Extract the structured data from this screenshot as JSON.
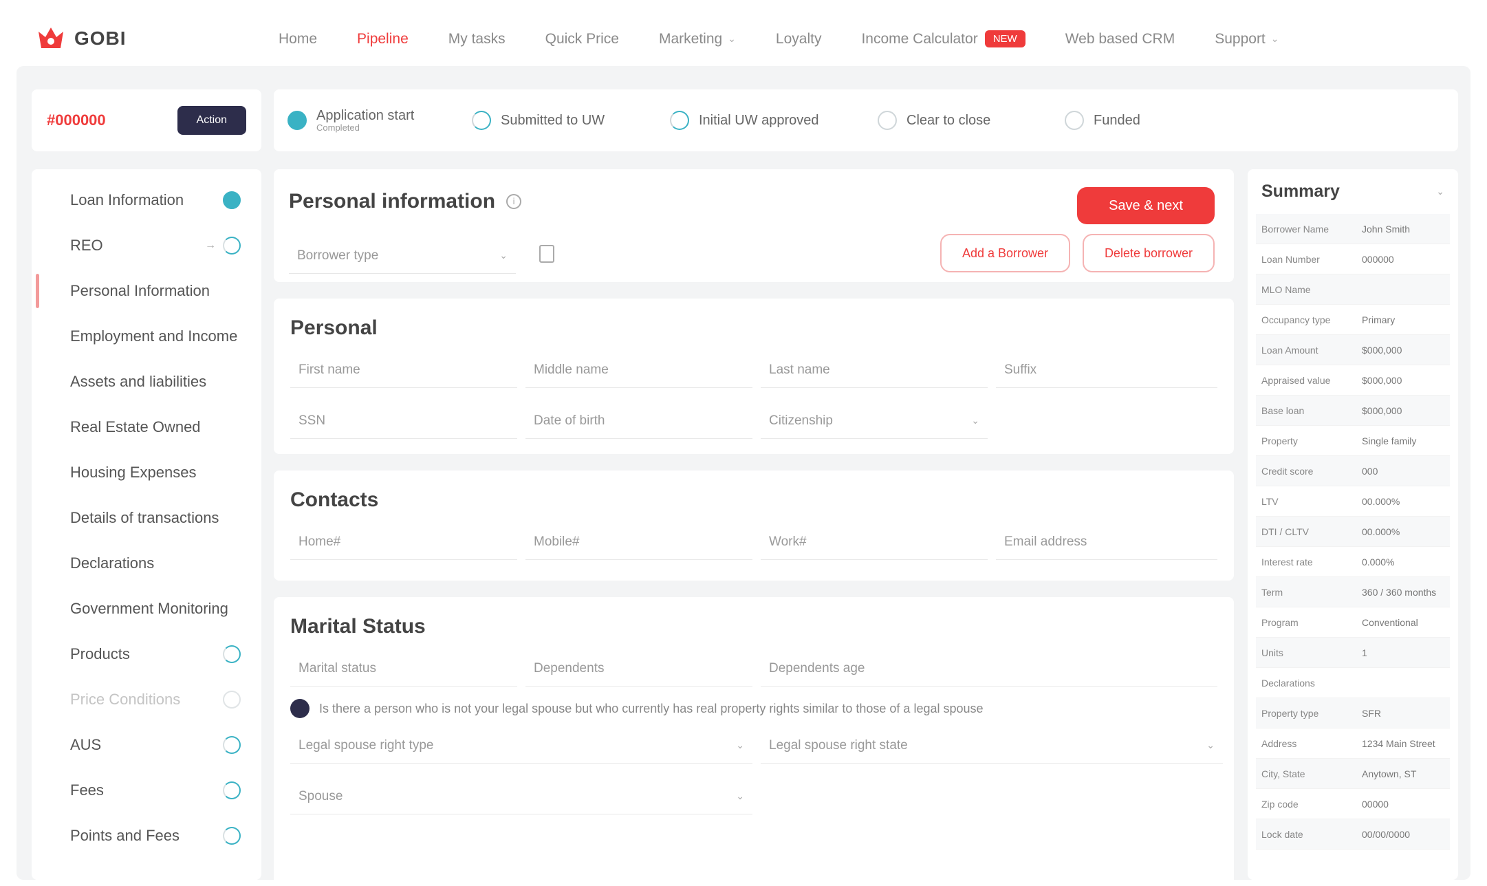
{
  "brand": {
    "name": "GOBI",
    "tagline": "",
    "accent": "#ef3b3b",
    "dark": "#2d2d4b",
    "teal": "#3ab2c4"
  },
  "nav": [
    {
      "label": "Home",
      "active": false,
      "dropdown": false
    },
    {
      "label": "Pipeline",
      "active": true,
      "dropdown": false
    },
    {
      "label": "My tasks",
      "active": false,
      "dropdown": false
    },
    {
      "label": "Quick Price",
      "active": false,
      "dropdown": false
    },
    {
      "label": "Marketing",
      "active": false,
      "dropdown": true
    },
    {
      "label": "Loyalty",
      "active": false,
      "dropdown": false
    },
    {
      "label": "Income Calculator",
      "active": false,
      "dropdown": false,
      "badge": "NEW"
    },
    {
      "label": "Web based CRM",
      "active": false,
      "dropdown": false
    },
    {
      "label": "Support",
      "active": false,
      "dropdown": true
    }
  ],
  "user": {
    "name": "",
    "sub": ""
  },
  "loan": {
    "id": "#000000",
    "button_label": "Action"
  },
  "steps": [
    {
      "label": "Application start",
      "sub": "Completed",
      "state": "done"
    },
    {
      "label": "Submitted to UW",
      "state": "half"
    },
    {
      "label": "Initial UW approved",
      "state": "half"
    },
    {
      "label": "Clear to close",
      "state": "empty"
    },
    {
      "label": "Funded",
      "state": "empty"
    }
  ],
  "sidebar": [
    {
      "label": "Loan Information",
      "icon": "done",
      "active": false,
      "muted": false
    },
    {
      "label": "REO",
      "icon": "half",
      "arrow": true,
      "active": false,
      "muted": false
    },
    {
      "label": "Personal Information",
      "icon": "none",
      "active": true,
      "muted": false
    },
    {
      "label": "Employment and Income",
      "icon": "none",
      "active": false,
      "muted": false
    },
    {
      "label": "Assets and liabilities",
      "icon": "none",
      "active": false,
      "muted": false
    },
    {
      "label": "Real Estate Owned",
      "icon": "none",
      "active": false,
      "muted": false
    },
    {
      "label": "Housing Expenses",
      "icon": "none",
      "active": false,
      "muted": false
    },
    {
      "label": "Details of transactions",
      "icon": "none",
      "active": false,
      "muted": false
    },
    {
      "label": "Declarations",
      "icon": "none",
      "active": false,
      "muted": false
    },
    {
      "label": "Government Monitoring",
      "icon": "none",
      "active": false,
      "muted": false
    },
    {
      "label": "Products",
      "icon": "half",
      "active": false,
      "muted": false
    },
    {
      "label": "Price Conditions",
      "icon": "empty",
      "active": false,
      "muted": true
    },
    {
      "label": "AUS",
      "icon": "half",
      "active": false,
      "muted": false
    },
    {
      "label": "Fees",
      "icon": "half",
      "active": false,
      "muted": false
    },
    {
      "label": "Points and Fees",
      "icon": "half",
      "active": false,
      "muted": false
    }
  ],
  "header": {
    "title": "Personal information",
    "primary_button": "Save & next",
    "borrower_placeholder": "Borrower type",
    "add_button": "Add a Borrower",
    "delete_button": "Delete borrower"
  },
  "personal": {
    "title": "Personal",
    "row1": [
      "First name",
      "Middle name",
      "Last name",
      "Suffix"
    ],
    "row2": [
      "SSN",
      "Date of birth",
      "Citizenship"
    ]
  },
  "contacts": {
    "title": "Contacts",
    "fields": [
      "Home#",
      "Mobile#",
      "Work#",
      "Email address"
    ]
  },
  "marital": {
    "title": "Marital Status",
    "fields": [
      "Marital status",
      "Dependents",
      "Dependents age"
    ],
    "checkbox_label": "Is there a person who is not your legal spouse but who currently has real property rights similar to those of a legal spouse",
    "legal_fields": [
      "Legal spouse right type",
      "Legal spouse right state"
    ],
    "extra_field": "Spouse"
  },
  "summary": {
    "title": "Summary",
    "rows": [
      [
        "Borrower Name",
        "John Smith"
      ],
      [
        "Loan Number",
        "000000"
      ],
      [
        "MLO Name",
        ""
      ],
      [
        "Occupancy type",
        "Primary"
      ],
      [
        "Loan Amount",
        "$000,000"
      ],
      [
        "Appraised value",
        "$000,000"
      ],
      [
        "Base loan",
        "$000,000"
      ],
      [
        "Property",
        "Single family"
      ],
      [
        "Credit score",
        "000"
      ],
      [
        "LTV",
        "00.000%"
      ],
      [
        "DTI / CLTV",
        "00.000%"
      ],
      [
        "Interest rate",
        "0.000%"
      ],
      [
        "Term",
        "360 / 360 months"
      ],
      [
        "Program",
        "Conventional"
      ],
      [
        "Units",
        "1"
      ],
      [
        "Declarations",
        ""
      ],
      [
        "Property type",
        "SFR"
      ],
      [
        "Address",
        "1234 Main Street"
      ],
      [
        "City, State",
        "Anytown, ST"
      ],
      [
        "Zip code",
        "00000"
      ],
      [
        "Lock date",
        "00/00/0000"
      ]
    ]
  }
}
